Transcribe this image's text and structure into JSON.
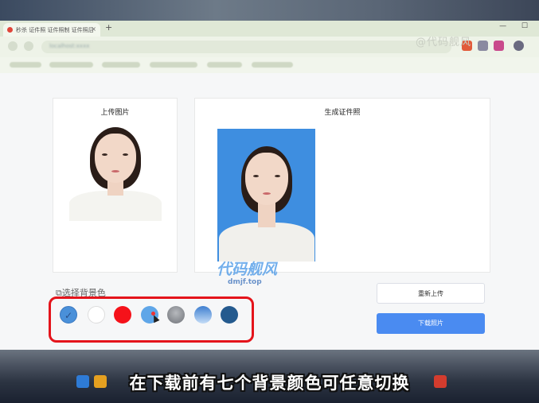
{
  "browser": {
    "tab_title": "秒杀 证件照 证件照制 证件照后",
    "new_tab": "+",
    "tab_close": "×",
    "window_controls": "— ☐",
    "address": "localhost:xxxx"
  },
  "watermark_top": "@代码舰风",
  "upload_card": {
    "title": "上传图片"
  },
  "result_card": {
    "title": "生成证件照",
    "photo_bg": "#3e8ee0"
  },
  "logo_watermark": {
    "text": "代码舰风",
    "domain": "dmjf.top"
  },
  "background_selector": {
    "label": "选择背景色",
    "colors": [
      {
        "name": "blue",
        "hex": "#4a90d9",
        "selected": true
      },
      {
        "name": "white",
        "hex": "#ffffff",
        "selected": false
      },
      {
        "name": "red",
        "hex": "#f5121a",
        "selected": false
      },
      {
        "name": "light-blue",
        "hex": "#5fa6e8",
        "selected": false
      },
      {
        "name": "gray",
        "hex": "#8c8f95",
        "selected": false
      },
      {
        "name": "gradient-blue",
        "hex": "#7aaee6",
        "selected": false
      },
      {
        "name": "dark-blue",
        "hex": "#245a8e",
        "selected": false
      }
    ],
    "check_mark": "✓"
  },
  "buttons": {
    "reupload": "重新上传",
    "download": "下载照片"
  },
  "caption": "在下载前有七个背景颜色可任意切换"
}
